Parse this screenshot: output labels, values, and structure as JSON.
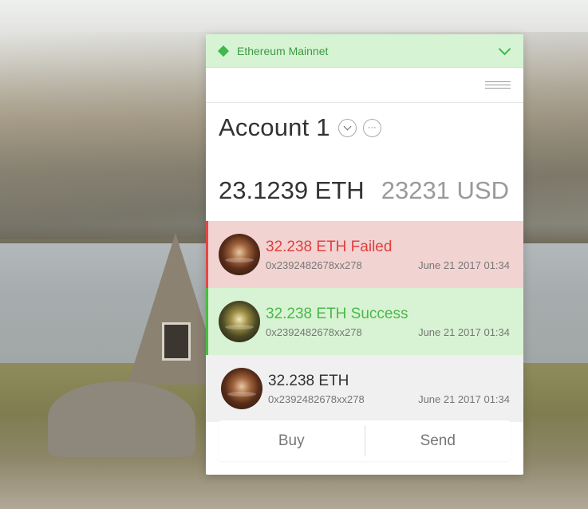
{
  "network": {
    "name": "Ethereum Mainnet",
    "status_color": "#3fb84c"
  },
  "account": {
    "name": "Account 1",
    "more_label": "···"
  },
  "balance": {
    "eth": "23.1239 ETH",
    "usd": "23231 USD"
  },
  "transactions": [
    {
      "title": "32.238 ETH  Failed",
      "address": "0x2392482678xx278",
      "date": "June 21 2017 01:34",
      "status": "failed"
    },
    {
      "title": "32.238 ETH Success",
      "address": "0x2392482678xx278",
      "date": "June 21 2017 01:34",
      "status": "success"
    },
    {
      "title": "32.238 ETH",
      "address": "0x2392482678xx278",
      "date": "June 21 2017 01:34",
      "status": "pending"
    }
  ],
  "actions": {
    "buy": "Buy",
    "send": "Send"
  },
  "colors": {
    "failed": "#e24745",
    "success": "#4bbc45",
    "network_bg": "#d6f4d3"
  }
}
